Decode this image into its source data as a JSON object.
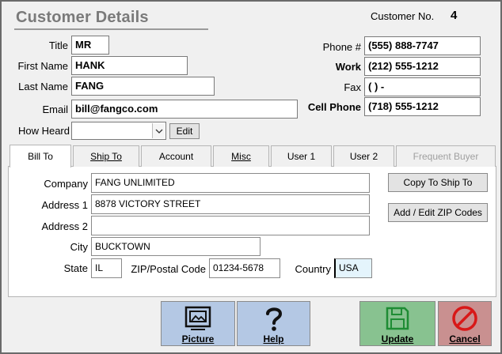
{
  "header": {
    "title": "Customer Details",
    "customer_no_label": "Customer No.",
    "customer_no_value": "4"
  },
  "left": {
    "title_label": "Title",
    "title_value": "MR",
    "first_name_label": "First Name",
    "first_name_value": "HANK",
    "last_name_label": "Last Name",
    "last_name_value": "FANG",
    "email_label": "Email",
    "email_value": "bill@fangco.com",
    "how_heard_label": "How Heard",
    "how_heard_value": "",
    "edit_label": "Edit"
  },
  "right": {
    "phone_label": "Phone #",
    "phone_value": "(555) 888-7747",
    "work_label": "Work",
    "work_value": "(212) 555-1212",
    "fax_label": "Fax",
    "fax_value": "(   )    -",
    "cell_label": "Cell Phone",
    "cell_value": "(718) 555-1212"
  },
  "tabs": [
    {
      "label": "Bill To"
    },
    {
      "label": "Ship To"
    },
    {
      "label": "Account"
    },
    {
      "label": "Misc"
    },
    {
      "label": "User 1"
    },
    {
      "label": "User 2"
    },
    {
      "label": "Frequent Buyer"
    }
  ],
  "bill_to": {
    "company_label": "Company",
    "company_value": "FANG UNLIMITED",
    "address1_label": "Address 1",
    "address1_value": "8878 VICTORY STREET",
    "address2_label": "Address 2",
    "address2_value": "",
    "city_label": "City",
    "city_value": "BUCKTOWN",
    "state_label": "State",
    "state_value": "IL",
    "zip_label": "ZIP/Postal Code",
    "zip_value": "01234-5678",
    "country_label": "Country",
    "country_value": "USA",
    "copy_to_ship_label": "Copy To Ship To",
    "zip_codes_label": "Add / Edit ZIP Codes"
  },
  "footer": {
    "picture_label": "Picture",
    "help_label": "Help",
    "update_label": "Update",
    "cancel_label": "Cancel"
  },
  "colors": {
    "blue_button": "#b4c8e4",
    "green_button": "#88c290",
    "red_button": "#c99090",
    "disabled_text": "#a0a0a0",
    "country_highlight": "#e4f4fc"
  }
}
